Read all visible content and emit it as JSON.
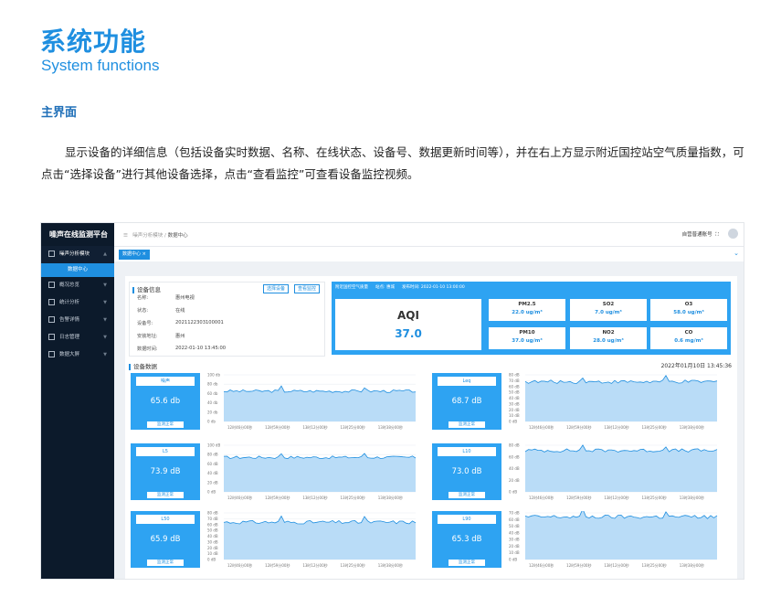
{
  "doc": {
    "title_cn": "系统功能",
    "title_en": "System functions",
    "section": "主界面",
    "description": "显示设备的详细信息（包括设备实时数据、名称、在线状态、设备号、数据更新时间等），并在右上方显示附近国控站空气质量指数，可点击“选择设备”进行其他设备选择，点击“查看监控”可查看设备监控视频。"
  },
  "app": {
    "brand": "噪声在线监测平台",
    "menu": [
      {
        "label": "噪声分析模块",
        "icon": "home-icon"
      },
      {
        "label": "数据中心",
        "icon": ""
      },
      {
        "label": "概况总览",
        "icon": "monitor-icon"
      },
      {
        "label": "统计分析",
        "icon": "bar-chart-icon"
      },
      {
        "label": "告警详情",
        "icon": "bell-icon"
      },
      {
        "label": "日志管理",
        "icon": "document-icon"
      },
      {
        "label": "数据大屏",
        "icon": "screen-icon"
      }
    ],
    "breadcrumb": {
      "root": "噪声分析模块",
      "sep": "/",
      "current": "数据中心"
    },
    "notice": "自营普通账号",
    "tab": "数据中心 ×"
  },
  "device": {
    "title": "设备信息",
    "btn_select": "选择设备",
    "btn_monitor": "查看监控",
    "rows": [
      {
        "k": "名称:",
        "v": "惠州电视"
      },
      {
        "k": "状态:",
        "v": "在线"
      },
      {
        "k": "设备号:",
        "v": "2021122303100001"
      },
      {
        "k": "安装地址:",
        "v": "惠州"
      },
      {
        "k": "数据时间:",
        "v": "2022-01-10 13:45:00"
      }
    ]
  },
  "air": {
    "title": "附近国控空气质量",
    "site": "站点: 惠城",
    "time": "发布时间: 2022-01-10 13:00:00",
    "aqi_label": "AQI",
    "aqi_value": "37.0",
    "pollutants": [
      {
        "name": "PM2.5",
        "value": "22.0 ug/m³"
      },
      {
        "name": "SO2",
        "value": "7.0 ug/m³"
      },
      {
        "name": "O3",
        "value": "58.0 ug/m³"
      },
      {
        "name": "PM10",
        "value": "37.0 ug/m³"
      },
      {
        "name": "NO2",
        "value": "28.0 ug/m³"
      },
      {
        "name": "CO",
        "value": "0.6 mg/m³"
      }
    ]
  },
  "data": {
    "title": "设备数据",
    "time": "2022年01月10日 13:45:36",
    "status": "监测正常",
    "x_ticks": [
      "12时46分00秒",
      "12时59分00秒",
      "13时12分00秒",
      "13时25分00秒",
      "13时38分00秒"
    ],
    "cards": [
      {
        "name": "噪声",
        "value": "65.6 db",
        "ticks": [
          "100 db",
          "80 db",
          "60 db",
          "40 db",
          "20 db",
          "0 db"
        ],
        "max": 100,
        "level": 65
      },
      {
        "name": "Leq",
        "value": "68.7 dB",
        "ticks": [
          "80 dB",
          "70 dB",
          "60 dB",
          "50 dB",
          "40 dB",
          "30 dB",
          "20 dB",
          "10 dB",
          "0 dB"
        ],
        "max": 80,
        "level": 68
      },
      {
        "name": "L5",
        "value": "73.9 dB",
        "ticks": [
          "100 dB",
          "80 dB",
          "60 dB",
          "40 dB",
          "20 dB",
          "0 dB"
        ],
        "max": 100,
        "level": 74
      },
      {
        "name": "L10",
        "value": "73.0 dB",
        "ticks": [
          "80 dB",
          "60 dB",
          "40 dB",
          "20 dB",
          "0 dB"
        ],
        "max": 80,
        "level": 71
      },
      {
        "name": "L50",
        "value": "65.9 dB",
        "ticks": [
          "80 dB",
          "70 dB",
          "60 dB",
          "50 dB",
          "40 dB",
          "30 dB",
          "20 dB",
          "10 dB",
          "0 dB"
        ],
        "max": 80,
        "level": 64
      },
      {
        "name": "L90",
        "value": "65.3 dB",
        "ticks": [
          "70 dB",
          "60 dB",
          "50 dB",
          "40 dB",
          "30 dB",
          "20 dB",
          "10 dB",
          "0 dB"
        ],
        "max": 70,
        "level": 64
      }
    ]
  },
  "colors": {
    "primary": "#1f8fe0",
    "panel": "#2ea3f2",
    "sidebar": "#0c1a2b",
    "area": "#b9dcf7"
  }
}
